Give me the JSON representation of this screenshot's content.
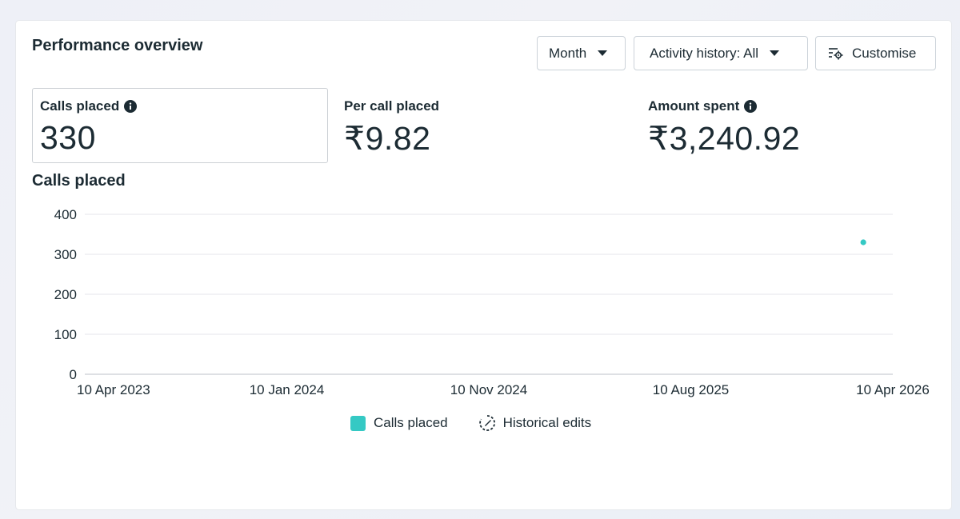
{
  "panel": {
    "title": "Performance overview"
  },
  "controls": {
    "period_label": "Month",
    "activity_label": "Activity history: All",
    "customise_label": "Customise"
  },
  "metrics": [
    {
      "label": "Calls placed",
      "value": "330",
      "info": true
    },
    {
      "label": "Per call placed",
      "value": "₹9.82",
      "info": false
    },
    {
      "label": "Amount spent",
      "value": "₹3,240.92",
      "info": true
    }
  ],
  "icons": {
    "dropdown": "chevron-down-icon",
    "customise": "customise-icon",
    "info": "info-icon",
    "historical_edits": "historical-edits-icon"
  },
  "colors": {
    "series": "#35c9c4",
    "grid": "#e4e6eb",
    "text": "#1c2b33"
  },
  "chart_data": {
    "type": "scatter",
    "title": "Calls placed",
    "ylim": [
      0,
      400
    ],
    "y_ticks": [
      "0",
      "100",
      "200",
      "300",
      "400"
    ],
    "x_ticks": [
      "10 Apr 2023",
      "10 Jan 2024",
      "10 Nov 2024",
      "10 Aug 2025",
      "10 Apr 2026"
    ],
    "x_range": [
      "2023-04-10",
      "2026-04-10"
    ],
    "grid": true,
    "series": [
      {
        "name": "Calls placed",
        "color": "#35c9c4",
        "points": [
          {
            "x": "2026-03-01",
            "y": 330
          }
        ]
      }
    ],
    "legend": [
      {
        "label": "Calls placed",
        "kind": "swatch"
      },
      {
        "label": "Historical edits",
        "kind": "icon"
      }
    ],
    "legend_position": "bottom"
  }
}
